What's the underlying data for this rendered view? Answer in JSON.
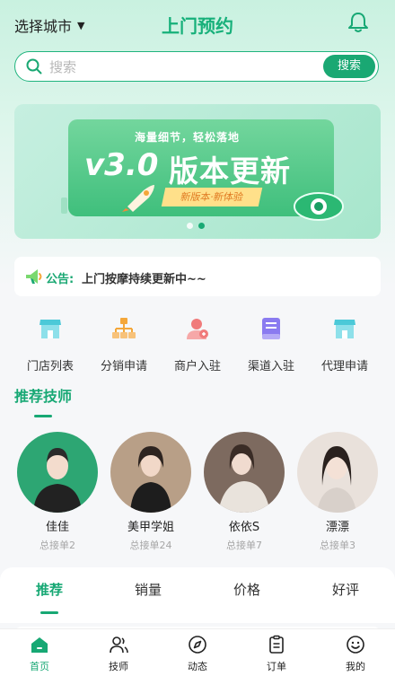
{
  "header": {
    "city_label": "选择城市",
    "title": "上门预约"
  },
  "search": {
    "placeholder": "搜索",
    "button": "搜索"
  },
  "banner": {
    "slogan": "海量细节，轻松落地",
    "version": "v3.0",
    "headline": "版本更新",
    "ribbon": "新版本·新体验",
    "slides": 2,
    "active_slide": 2
  },
  "notice": {
    "label": "公告:",
    "text": "上门按摩持续更新中~~"
  },
  "menu": [
    {
      "label": "门店列表",
      "icon": "store-icon",
      "color": "#4cc9d8"
    },
    {
      "label": "分销申请",
      "icon": "org-chart-icon",
      "color": "#f4a73a"
    },
    {
      "label": "商户入驻",
      "icon": "merchant-user-icon",
      "color": "#f07b7b"
    },
    {
      "label": "渠道入驻",
      "icon": "book-icon",
      "color": "#8a7bf0"
    },
    {
      "label": "代理申请",
      "icon": "store-icon",
      "color": "#4cc9d8"
    }
  ],
  "recommend": {
    "title": "推荐技师",
    "technicians": [
      {
        "name": "佳佳",
        "orders": "总接单2"
      },
      {
        "name": "美甲学姐",
        "orders": "总接单24"
      },
      {
        "name": "依依S",
        "orders": "总接单7"
      },
      {
        "name": "漂漂",
        "orders": "总接单3"
      }
    ]
  },
  "sort_tabs": [
    {
      "label": "推荐",
      "active": true
    },
    {
      "label": "销量",
      "active": false
    },
    {
      "label": "价格",
      "active": false
    },
    {
      "label": "好评",
      "active": false
    }
  ],
  "bottom_nav": [
    {
      "label": "首页",
      "icon": "home-icon",
      "active": true
    },
    {
      "label": "技师",
      "icon": "users-icon",
      "active": false
    },
    {
      "label": "动态",
      "icon": "compass-icon",
      "active": false
    },
    {
      "label": "订单",
      "icon": "clipboard-icon",
      "active": false
    },
    {
      "label": "我的",
      "icon": "smile-icon",
      "active": false
    }
  ],
  "colors": {
    "brand": "#17a874",
    "title": "#17b07a",
    "accent_orange": "#f4a73a"
  }
}
